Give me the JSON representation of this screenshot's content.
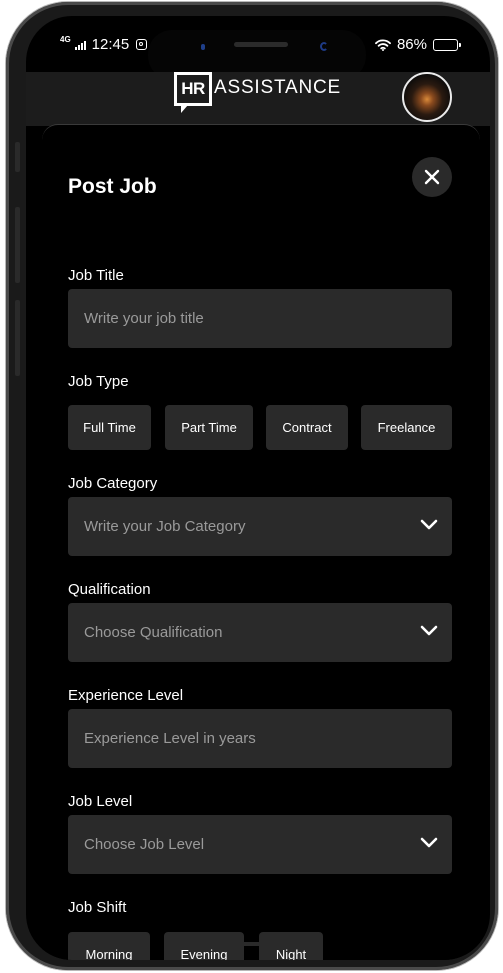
{
  "status_bar": {
    "time": "12:45",
    "network": "4G",
    "battery": "86%",
    "battery_level": 0.86
  },
  "header": {
    "logo_badge": "HR",
    "logo_text": "ASSISTANCE"
  },
  "form": {
    "title": "Post Job",
    "job_title": {
      "label": "Job Title",
      "placeholder": "Write your job title"
    },
    "job_type": {
      "label": "Job Type",
      "options": [
        "Full Time",
        "Part Time",
        "Contract",
        "Freelance"
      ]
    },
    "job_category": {
      "label": "Job Category",
      "placeholder": "Write your Job Category"
    },
    "qualification": {
      "label": "Qualification",
      "placeholder": "Choose Qualification"
    },
    "experience_level": {
      "label": "Experience Level",
      "placeholder": "Experience Level in years"
    },
    "job_level": {
      "label": "Job Level",
      "placeholder": "Choose Job Level"
    },
    "job_shift": {
      "label": "Job Shift",
      "options": [
        "Morning",
        "Evening",
        "Night"
      ]
    }
  },
  "icons": {
    "close": "close-icon",
    "chevron": "chevron-down-icon",
    "wifi": "wifi-icon",
    "signal": "signal-icon",
    "battery": "battery-icon",
    "camera_app": "instagram-icon"
  }
}
